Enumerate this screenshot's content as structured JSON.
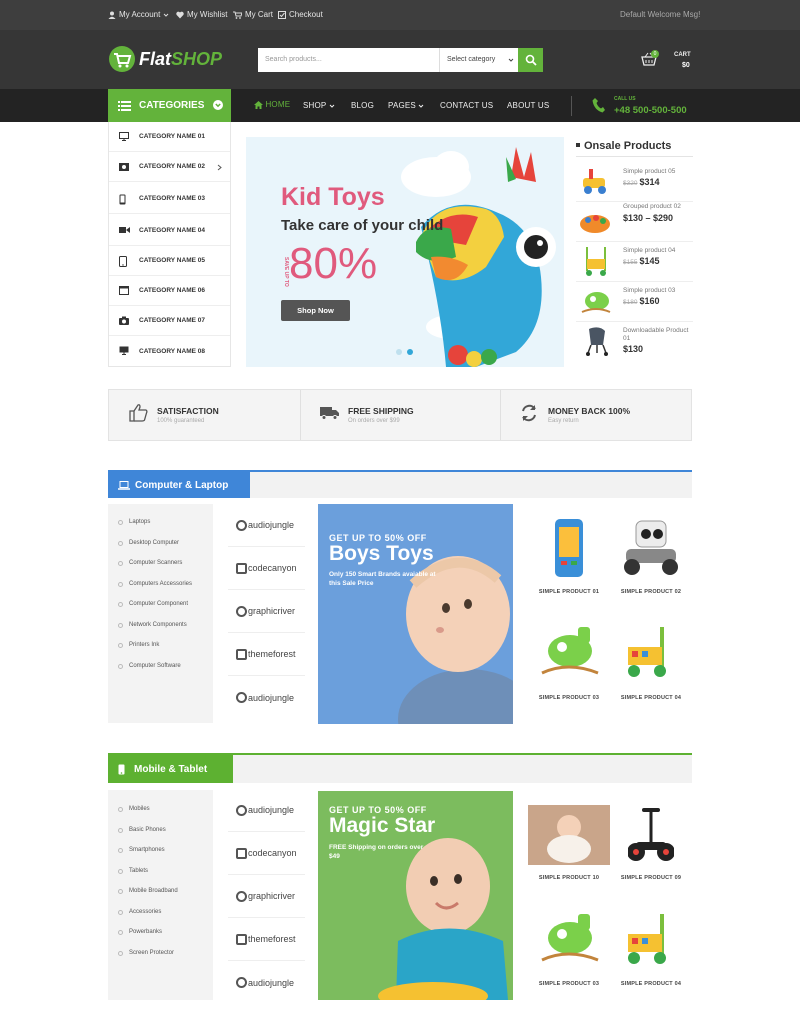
{
  "topbar": {
    "my_account": "My Account",
    "my_wishlist": "My Wishlist",
    "my_cart": "My Cart",
    "checkout": "Checkout",
    "welcome": "Default Welcome Msg!"
  },
  "header": {
    "logo_part1": "Flat",
    "logo_part2": "SHOP",
    "search_placeholder": "Search products...",
    "category_select": "Select category",
    "cart_label": "CART",
    "cart_total": "$0",
    "cart_count": "0"
  },
  "nav": {
    "categories_label": "CATEGORIES",
    "items": [
      "HOME",
      "SHOP",
      "BLOG",
      "PAGES",
      "CONTACT US",
      "ABOUT US"
    ],
    "call_label": "CALL US",
    "phone": "+48 500-500-500"
  },
  "categories": [
    "CATEGORY NAME 01",
    "CATEGORY NAME 02",
    "CATEGORY NAME 03",
    "CATEGORY NAME 04",
    "CATEGORY NAME 05",
    "CATEGORY NAME 06",
    "CATEGORY NAME 07",
    "CATEGORY NAME 08"
  ],
  "hero": {
    "title": "Kid Toys",
    "subtitle": "Take care of your child",
    "save_label": "SAVE UP TO",
    "discount": "80%",
    "button": "Shop Now"
  },
  "onsale": {
    "title": "Onsale Products",
    "items": [
      {
        "name": "Simple product 05",
        "old": "$320",
        "price": "$314"
      },
      {
        "name": "Grouped product 02",
        "old": "",
        "price": "$130 – $290"
      },
      {
        "name": "Simple product 04",
        "old": "$155",
        "price": "$145"
      },
      {
        "name": "Simple product 03",
        "old": "$180",
        "price": "$160"
      },
      {
        "name": "Downloadable Product 01",
        "old": "",
        "price": "$130"
      }
    ]
  },
  "features": [
    {
      "title": "SATISFACTION",
      "sub": "100% guaranteed"
    },
    {
      "title": "FREE SHIPPING",
      "sub": "On orders over $99"
    },
    {
      "title": "MONEY BACK 100%",
      "sub": "Easy return"
    }
  ],
  "section1": {
    "title": "Computer & Laptop",
    "color": "#3f86d8",
    "subcats": [
      "Laptops",
      "Desktop Computer",
      "Computer Scanners",
      "Computers Accessories",
      "Computer Component",
      "Network Components",
      "Printers Ink",
      "Computer Software"
    ],
    "brands": [
      "audiojungle",
      "codecanyon",
      "graphicriver",
      "themeforest",
      "audiojungle"
    ],
    "promo": {
      "line1": "GET UP TO 50% OFF",
      "line2": "Boys Toys",
      "line3": "Only 150 Smart Brands avaiable at this Sale Price"
    },
    "products": [
      "SIMPLE PRODUCT 01",
      "SIMPLE PRODUCT 02",
      "SIMPLE PRODUCT 03",
      "SIMPLE PRODUCT 04"
    ]
  },
  "section2": {
    "title": "Mobile & Tablet",
    "color": "#5db131",
    "subcats": [
      "Mobiles",
      "Basic Phones",
      "Smartphones",
      "Tablets",
      "Mobile Broadband",
      "Accessories",
      "Powerbanks",
      "Screen Protector"
    ],
    "brands": [
      "audiojungle",
      "codecanyon",
      "graphicriver",
      "themeforest",
      "audiojungle"
    ],
    "promo": {
      "line1": "GET UP TO 50% OFF",
      "line2": "Magic Star",
      "line3": "FREE Shipping on orders over $49"
    },
    "products": [
      "SIMPLE PRODUCT 10",
      "SIMPLE PRODUCT 09",
      "SIMPLE PRODUCT 03",
      "SIMPLE PRODUCT 04"
    ]
  },
  "colors": {
    "accent": "#63b33b",
    "dark": "#363636",
    "hero_pink": "#e05a7d"
  }
}
